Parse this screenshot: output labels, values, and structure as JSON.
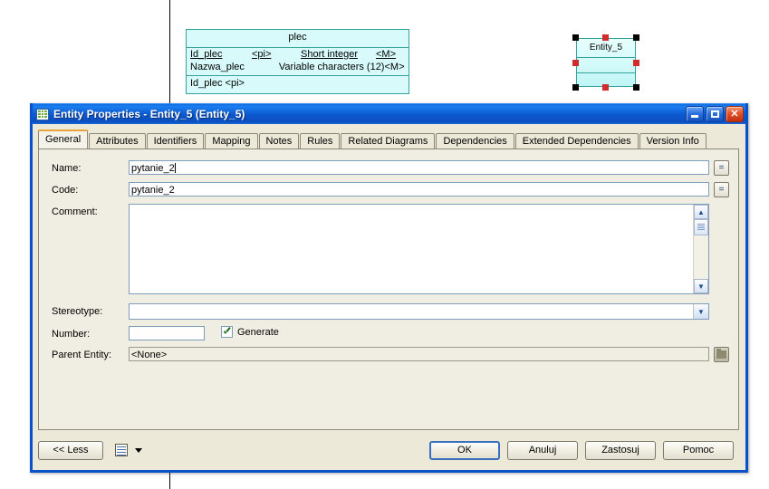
{
  "canvas": {
    "entity_plec": {
      "title": "plec",
      "attributes": [
        {
          "name": "Id_plec",
          "pi": "<pi>",
          "type": "Short integer",
          "mandatory": "<M>"
        },
        {
          "name": "Nazwa_plec",
          "pi": "",
          "type": "Variable characters (12)",
          "mandatory": "<M>"
        }
      ],
      "identifiers": [
        "Id_plec  <pi>"
      ]
    },
    "entity_selected": {
      "title": "Entity_5"
    }
  },
  "dialog": {
    "title": "Entity Properties - Entity_5 (Entity_5)",
    "icon": "table-grid-icon",
    "window_buttons": {
      "minimize": "minimize-button",
      "maximize": "maximize-button",
      "close": "close-button"
    },
    "tabs": [
      {
        "label": "General",
        "active": true
      },
      {
        "label": "Attributes",
        "active": false
      },
      {
        "label": "Identifiers",
        "active": false
      },
      {
        "label": "Mapping",
        "active": false
      },
      {
        "label": "Notes",
        "active": false
      },
      {
        "label": "Rules",
        "active": false
      },
      {
        "label": "Related Diagrams",
        "active": false
      },
      {
        "label": "Dependencies",
        "active": false
      },
      {
        "label": "Extended Dependencies",
        "active": false
      },
      {
        "label": "Version Info",
        "active": false
      }
    ],
    "fields": {
      "name_label": "Name:",
      "name_value": "pytanie_2",
      "code_label": "Code:",
      "code_value": "pytanie_2",
      "comment_label": "Comment:",
      "comment_value": "",
      "stereotype_label": "Stereotype:",
      "stereotype_value": "",
      "number_label": "Number:",
      "number_value": "",
      "generate_label": "Generate",
      "generate_checked": true,
      "parent_entity_label": "Parent Entity:",
      "parent_entity_value": "<None>"
    },
    "buttons": {
      "less": "<< Less",
      "ok": "OK",
      "cancel": "Anuluj",
      "apply": "Zastosuj",
      "help": "Pomoc"
    }
  },
  "colors": {
    "titlebar_blue": "#0d58cf",
    "dialog_face": "#ece9d8",
    "entity_fill": "#d8fafa",
    "entity_border": "#35a39b",
    "active_tab_accent": "#e8a33d",
    "handle_red": "#d12b2b"
  }
}
